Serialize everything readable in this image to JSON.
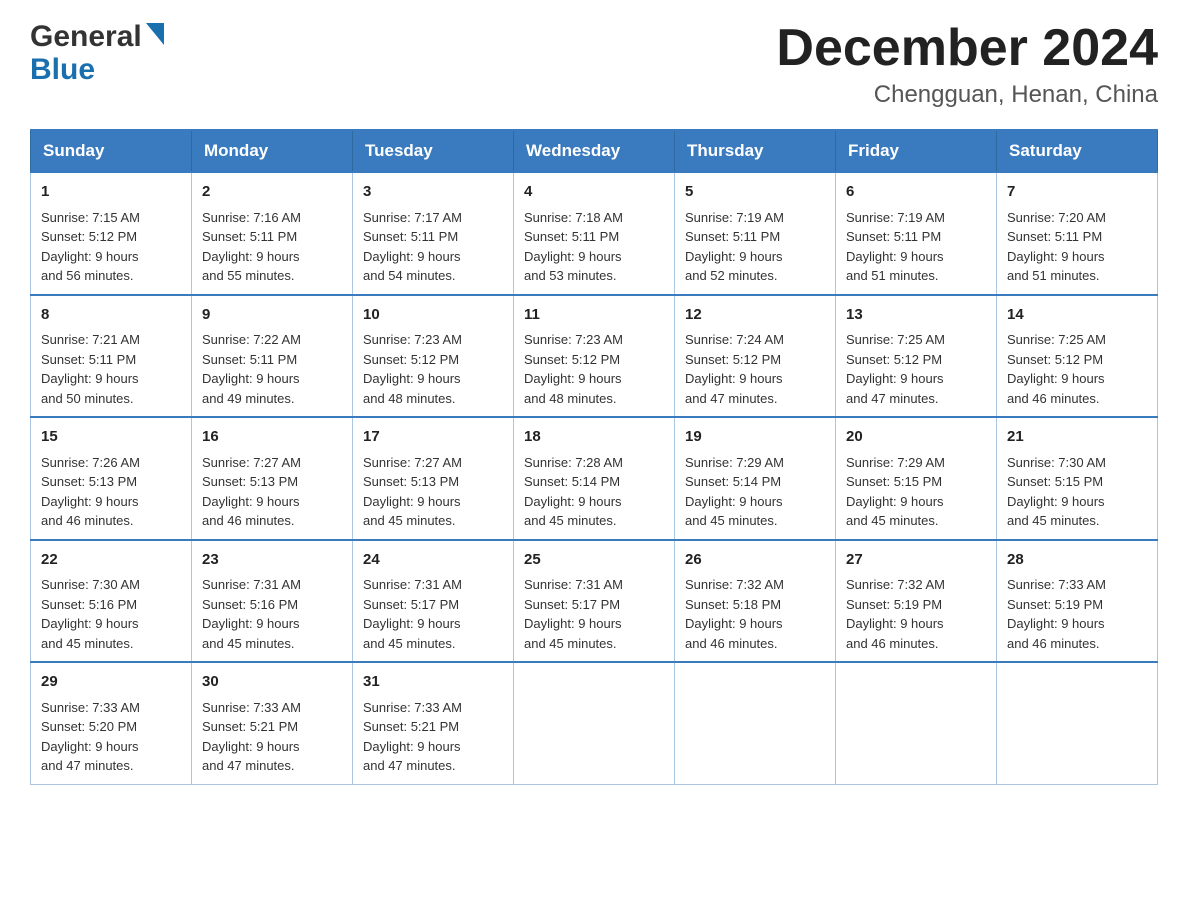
{
  "header": {
    "logo_general": "General",
    "logo_blue": "Blue",
    "month_title": "December 2024",
    "location": "Chengguan, Henan, China"
  },
  "days_of_week": [
    "Sunday",
    "Monday",
    "Tuesday",
    "Wednesday",
    "Thursday",
    "Friday",
    "Saturday"
  ],
  "weeks": [
    [
      {
        "day": "1",
        "sunrise": "7:15 AM",
        "sunset": "5:12 PM",
        "daylight": "9 hours and 56 minutes."
      },
      {
        "day": "2",
        "sunrise": "7:16 AM",
        "sunset": "5:11 PM",
        "daylight": "9 hours and 55 minutes."
      },
      {
        "day": "3",
        "sunrise": "7:17 AM",
        "sunset": "5:11 PM",
        "daylight": "9 hours and 54 minutes."
      },
      {
        "day": "4",
        "sunrise": "7:18 AM",
        "sunset": "5:11 PM",
        "daylight": "9 hours and 53 minutes."
      },
      {
        "day": "5",
        "sunrise": "7:19 AM",
        "sunset": "5:11 PM",
        "daylight": "9 hours and 52 minutes."
      },
      {
        "day": "6",
        "sunrise": "7:19 AM",
        "sunset": "5:11 PM",
        "daylight": "9 hours and 51 minutes."
      },
      {
        "day": "7",
        "sunrise": "7:20 AM",
        "sunset": "5:11 PM",
        "daylight": "9 hours and 51 minutes."
      }
    ],
    [
      {
        "day": "8",
        "sunrise": "7:21 AM",
        "sunset": "5:11 PM",
        "daylight": "9 hours and 50 minutes."
      },
      {
        "day": "9",
        "sunrise": "7:22 AM",
        "sunset": "5:11 PM",
        "daylight": "9 hours and 49 minutes."
      },
      {
        "day": "10",
        "sunrise": "7:23 AM",
        "sunset": "5:12 PM",
        "daylight": "9 hours and 48 minutes."
      },
      {
        "day": "11",
        "sunrise": "7:23 AM",
        "sunset": "5:12 PM",
        "daylight": "9 hours and 48 minutes."
      },
      {
        "day": "12",
        "sunrise": "7:24 AM",
        "sunset": "5:12 PM",
        "daylight": "9 hours and 47 minutes."
      },
      {
        "day": "13",
        "sunrise": "7:25 AM",
        "sunset": "5:12 PM",
        "daylight": "9 hours and 47 minutes."
      },
      {
        "day": "14",
        "sunrise": "7:25 AM",
        "sunset": "5:12 PM",
        "daylight": "9 hours and 46 minutes."
      }
    ],
    [
      {
        "day": "15",
        "sunrise": "7:26 AM",
        "sunset": "5:13 PM",
        "daylight": "9 hours and 46 minutes."
      },
      {
        "day": "16",
        "sunrise": "7:27 AM",
        "sunset": "5:13 PM",
        "daylight": "9 hours and 46 minutes."
      },
      {
        "day": "17",
        "sunrise": "7:27 AM",
        "sunset": "5:13 PM",
        "daylight": "9 hours and 45 minutes."
      },
      {
        "day": "18",
        "sunrise": "7:28 AM",
        "sunset": "5:14 PM",
        "daylight": "9 hours and 45 minutes."
      },
      {
        "day": "19",
        "sunrise": "7:29 AM",
        "sunset": "5:14 PM",
        "daylight": "9 hours and 45 minutes."
      },
      {
        "day": "20",
        "sunrise": "7:29 AM",
        "sunset": "5:15 PM",
        "daylight": "9 hours and 45 minutes."
      },
      {
        "day": "21",
        "sunrise": "7:30 AM",
        "sunset": "5:15 PM",
        "daylight": "9 hours and 45 minutes."
      }
    ],
    [
      {
        "day": "22",
        "sunrise": "7:30 AM",
        "sunset": "5:16 PM",
        "daylight": "9 hours and 45 minutes."
      },
      {
        "day": "23",
        "sunrise": "7:31 AM",
        "sunset": "5:16 PM",
        "daylight": "9 hours and 45 minutes."
      },
      {
        "day": "24",
        "sunrise": "7:31 AM",
        "sunset": "5:17 PM",
        "daylight": "9 hours and 45 minutes."
      },
      {
        "day": "25",
        "sunrise": "7:31 AM",
        "sunset": "5:17 PM",
        "daylight": "9 hours and 45 minutes."
      },
      {
        "day": "26",
        "sunrise": "7:32 AM",
        "sunset": "5:18 PM",
        "daylight": "9 hours and 46 minutes."
      },
      {
        "day": "27",
        "sunrise": "7:32 AM",
        "sunset": "5:19 PM",
        "daylight": "9 hours and 46 minutes."
      },
      {
        "day": "28",
        "sunrise": "7:33 AM",
        "sunset": "5:19 PM",
        "daylight": "9 hours and 46 minutes."
      }
    ],
    [
      {
        "day": "29",
        "sunrise": "7:33 AM",
        "sunset": "5:20 PM",
        "daylight": "9 hours and 47 minutes."
      },
      {
        "day": "30",
        "sunrise": "7:33 AM",
        "sunset": "5:21 PM",
        "daylight": "9 hours and 47 minutes."
      },
      {
        "day": "31",
        "sunrise": "7:33 AM",
        "sunset": "5:21 PM",
        "daylight": "9 hours and 47 minutes."
      },
      null,
      null,
      null,
      null
    ]
  ],
  "labels": {
    "sunrise": "Sunrise:",
    "sunset": "Sunset:",
    "daylight": "Daylight:"
  }
}
